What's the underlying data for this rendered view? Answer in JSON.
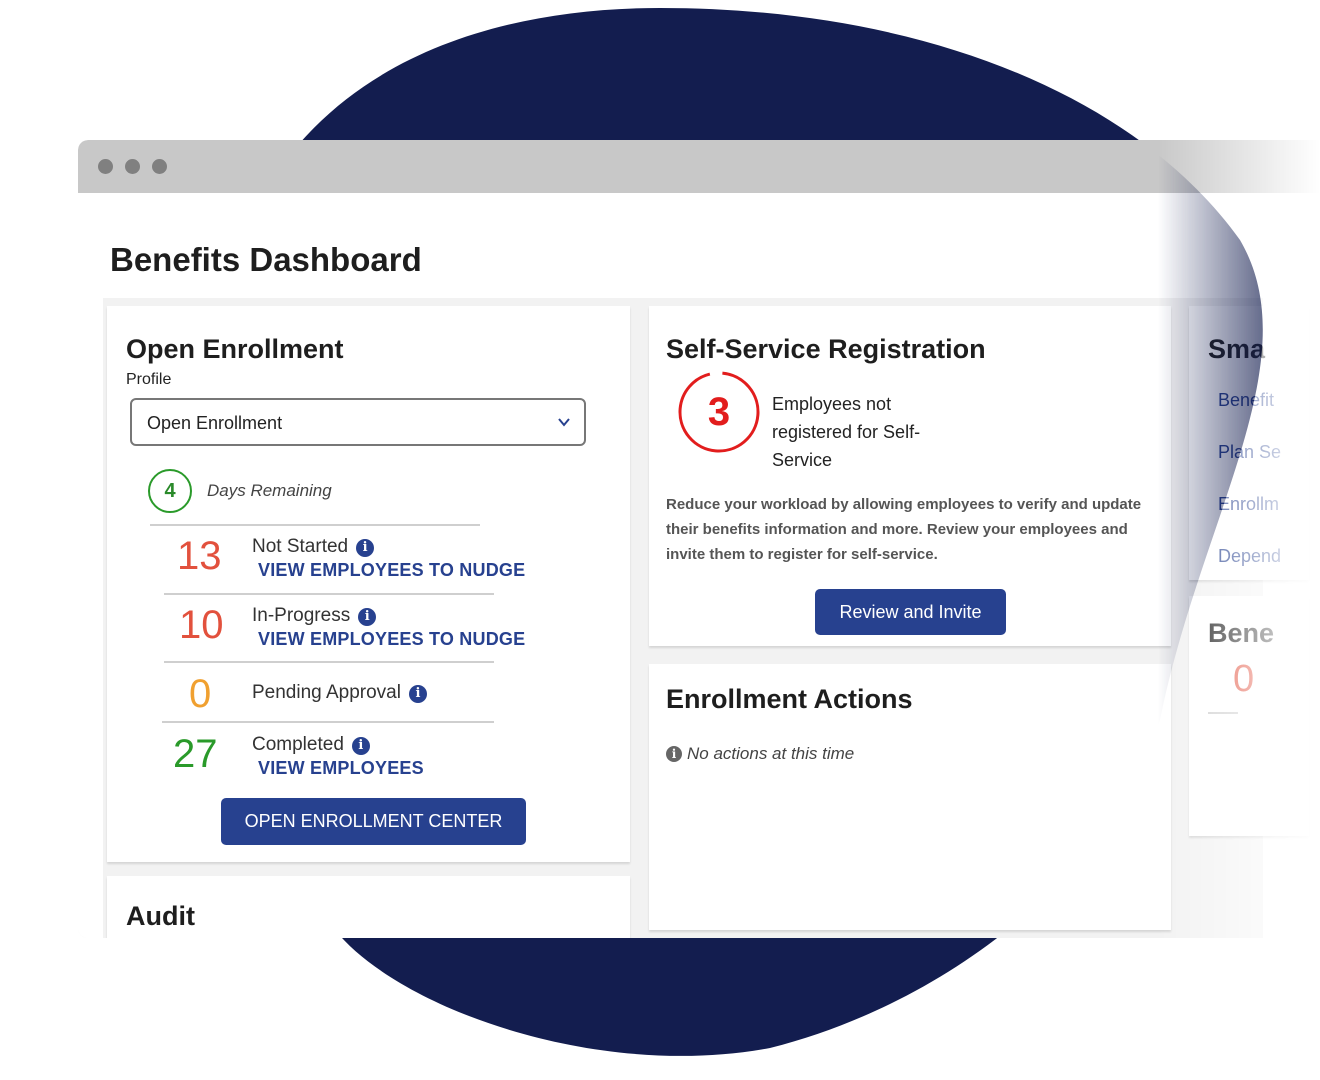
{
  "colors": {
    "brand_navy": "#131d4f",
    "primary_blue": "#27418f",
    "not_started": "#e2513d",
    "in_progress": "#e2513d",
    "pending": "#f0a030",
    "completed": "#2a9a2a",
    "ss_red": "#e21d1d"
  },
  "page": {
    "title": "Benefits Dashboard"
  },
  "open_enrollment": {
    "title": "Open Enrollment",
    "profile_label": "Profile",
    "profile_value": "Open Enrollment",
    "dropdown_icon": "chevron-down-icon",
    "days_remaining": "4",
    "days_label": "Days Remaining",
    "stats": [
      {
        "count": "13",
        "label": "Not Started",
        "link": "VIEW EMPLOYEES TO NUDGE"
      },
      {
        "count": "10",
        "label": "In-Progress",
        "link": "VIEW EMPLOYEES TO NUDGE"
      },
      {
        "count": "0",
        "label": "Pending Approval",
        "link": ""
      },
      {
        "count": "27",
        "label": "Completed",
        "link": "VIEW EMPLOYEES"
      }
    ],
    "button": "OPEN ENROLLMENT CENTER"
  },
  "audit": {
    "title": "Audit"
  },
  "self_service": {
    "title": "Self-Service Registration",
    "count": "3",
    "count_label": "Employees not registered for Self-Service",
    "description": "Reduce your workload by allowing employees to verify and update their benefits information and more. Review your employees and invite them to register for self-service.",
    "button": "Review and Invite"
  },
  "enrollment_actions": {
    "title": "Enrollment Actions",
    "empty_text": "No actions at this time",
    "icon": "info-icon"
  },
  "smart_card": {
    "title": "Sma",
    "links": [
      "Benefit",
      "Plan Se",
      "Enrollm",
      "Depend"
    ]
  },
  "bene_card": {
    "title": "Bene",
    "value": "0"
  }
}
